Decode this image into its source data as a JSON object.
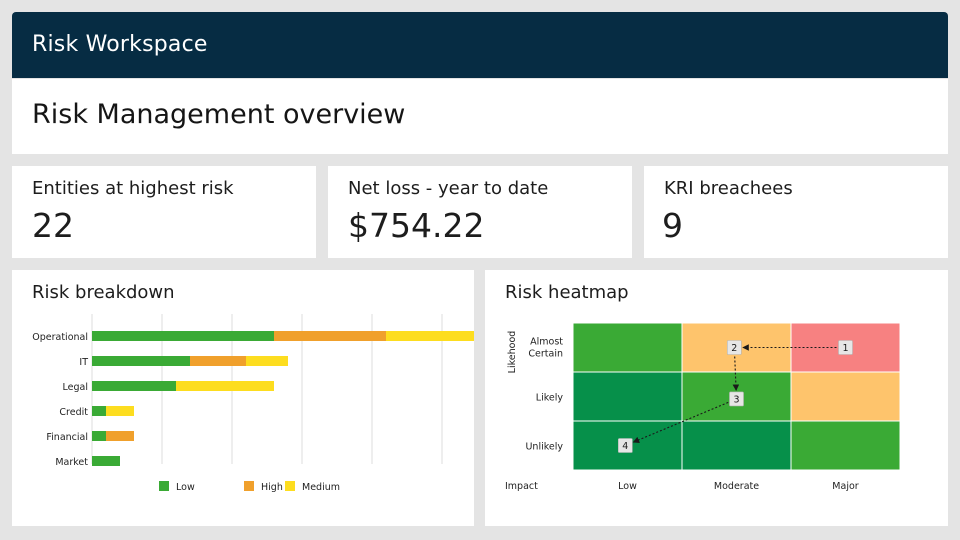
{
  "header": {
    "app_title": "Risk Workspace"
  },
  "page": {
    "title": "Risk Management overview"
  },
  "kpis": [
    {
      "label": "Entities at highest risk",
      "value": "22"
    },
    {
      "label": "Net loss - year to date",
      "value": "$754.22"
    },
    {
      "label": "KRI breachees",
      "value": "9"
    }
  ],
  "breakdown": {
    "title": "Risk breakdown",
    "chart_data": {
      "type": "bar",
      "stacked": true,
      "orientation": "horizontal",
      "categories": [
        "Operational",
        "IT",
        "Legal",
        "Credit",
        "Financial",
        "Market"
      ],
      "series": [
        {
          "name": "Low",
          "color": "#3aaa35",
          "values": [
            13,
            7,
            6,
            1,
            1,
            2
          ]
        },
        {
          "name": "High",
          "color": "#f0a02c",
          "values": [
            8,
            4,
            0,
            0,
            2,
            0
          ]
        },
        {
          "name": "Medium",
          "color": "#fddd1f",
          "values": [
            7,
            3,
            7,
            2,
            0,
            0
          ]
        }
      ],
      "xlim": [
        0,
        25
      ],
      "grid": true,
      "legend_position": "bottom"
    }
  },
  "heatmap": {
    "title": "Risk heatmap",
    "y_axis_title": "Likehood",
    "x_axis_title": "Impact",
    "rows": [
      "Almost Certain",
      "Likely",
      "Unlikely"
    ],
    "columns": [
      "Low",
      "Moderate",
      "Major"
    ],
    "cells": [
      [
        "#3aaa35",
        "#fec46c",
        "#f78181"
      ],
      [
        "#06904a",
        "#3aaa35",
        "#fec46c"
      ],
      [
        "#06904a",
        "#06904a",
        "#3aaa35"
      ]
    ],
    "markers": [
      {
        "label": "1",
        "row": "Almost Certain",
        "column": "Major"
      },
      {
        "label": "2",
        "row": "Almost Certain",
        "column": "Moderate"
      },
      {
        "label": "3",
        "row": "Likely",
        "column": "Moderate"
      },
      {
        "label": "4",
        "row": "Unlikely",
        "column": "Low"
      }
    ],
    "path": [
      "1",
      "2",
      "3",
      "4"
    ]
  }
}
